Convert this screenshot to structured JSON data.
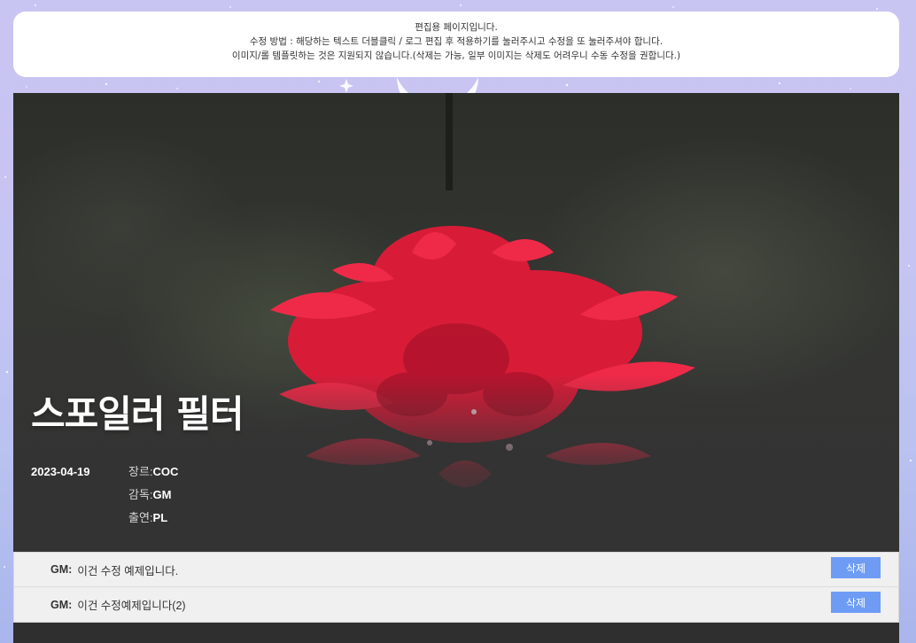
{
  "notice": {
    "line1": "편집용 페이지입니다.",
    "line2": "수정 방법 : 해당하는 텍스트 더블클릭 / 로그 편집 후 적용하기를 눌러주시고 수정을 또 눌러주셔야 합니다.",
    "line3": "이미지/롤 템플릿하는 것은 지원되지 않습니다.(삭제는 가능, 일부 이미지는 삭제도 어려우니 수동 수정을 권합니다.)"
  },
  "post": {
    "title": "스포일러 필터",
    "date": "2023-04-19",
    "genre_label": "장르:",
    "genre_value": "COC",
    "director_label": "감독:",
    "director_value": "GM",
    "cast_label": "출연:",
    "cast_value": "PL"
  },
  "comments": [
    {
      "author": "GM:",
      "text": "이건 수정 예제입니다.",
      "delete_label": "삭제"
    },
    {
      "author": "GM:",
      "text": "이건 수정예제입니다(2)",
      "delete_label": "삭제"
    }
  ],
  "colors": {
    "accent": "#6e9cf5",
    "flower": "#e8223f",
    "panel": "#333333"
  }
}
